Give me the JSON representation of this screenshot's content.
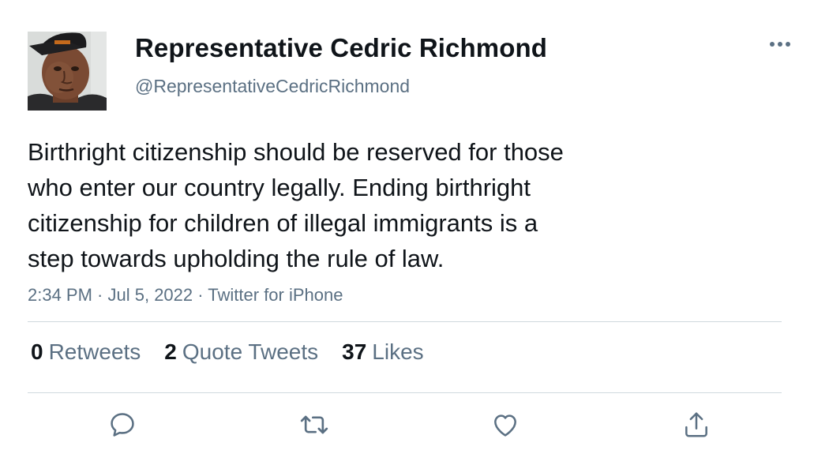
{
  "author": {
    "display_name": "Representative Cedric Richmond",
    "handle": "@RepresentativeCedricRichmond"
  },
  "tweet": {
    "text_lines": [
      "Birthright citizenship should be reserved for those",
      "who enter our country legally. Ending birthright",
      "citizenship for children of illegal immigrants is a",
      "step towards upholding the rule of law."
    ],
    "time": "2:34 PM",
    "date": "Jul 5, 2022",
    "source": "Twitter for iPhone",
    "separator": " · "
  },
  "stats": {
    "retweets": {
      "count": "0",
      "label": "Retweets"
    },
    "quotes": {
      "count": "2",
      "label": "Quote Tweets"
    },
    "likes": {
      "count": "37",
      "label": "Likes"
    }
  },
  "icons": {
    "more": "more-horizontal-icon",
    "reply": "reply-icon",
    "retweet": "retweet-icon",
    "like": "heart-icon",
    "share": "share-icon"
  },
  "colors": {
    "text": "#0f1419",
    "secondary": "#5b7083",
    "divider": "#cfd9de",
    "icon": "#5b7083"
  }
}
